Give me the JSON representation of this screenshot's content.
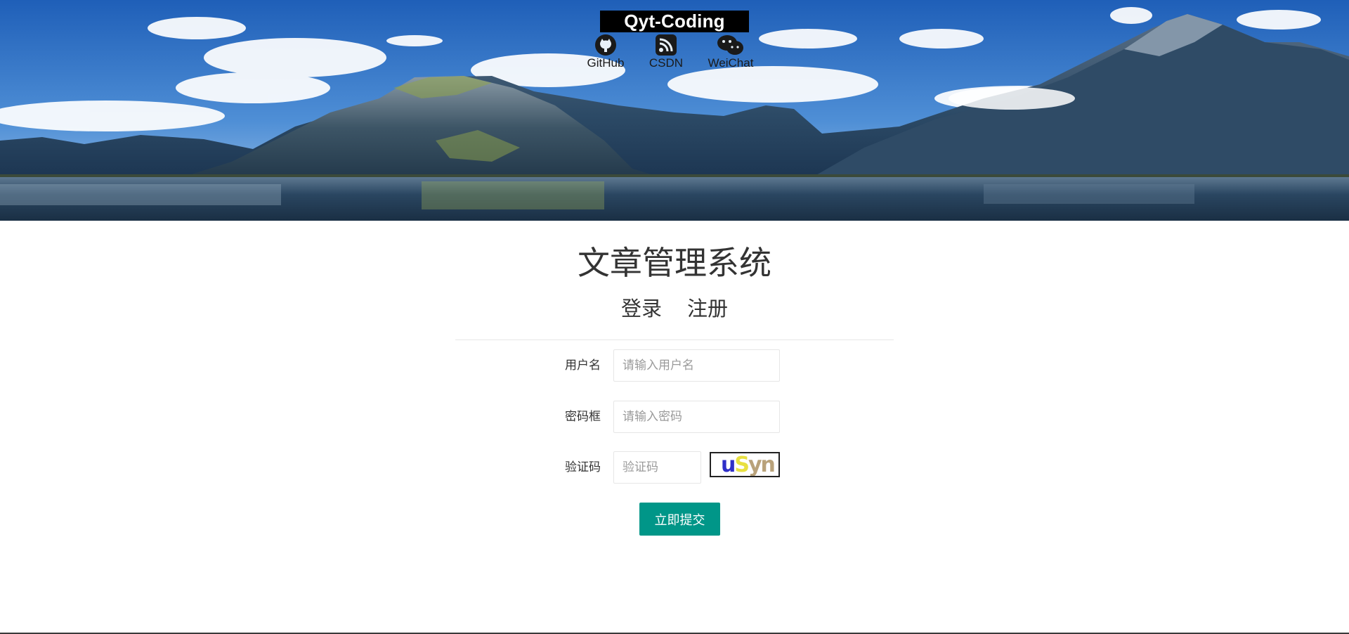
{
  "header": {
    "brand": "Qyt-Coding",
    "links": [
      {
        "label": "GitHub",
        "icon": "github-icon"
      },
      {
        "label": "CSDN",
        "icon": "rss-icon"
      },
      {
        "label": "WeiChat",
        "icon": "wechat-icon"
      }
    ]
  },
  "main": {
    "title": "文章管理系统",
    "tabs": [
      {
        "label": "登录"
      },
      {
        "label": "注册"
      }
    ]
  },
  "form": {
    "username": {
      "label": "用户名",
      "placeholder": "请输入用户名",
      "value": ""
    },
    "password": {
      "label": "密码框",
      "placeholder": "请输入密码",
      "value": ""
    },
    "captcha": {
      "label": "验证码",
      "placeholder": "验证码",
      "value": "",
      "image_text": [
        "u",
        "S",
        "yn"
      ]
    },
    "submit_label": "立即提交"
  },
  "colors": {
    "accent": "#009688",
    "brand_bg": "#000000",
    "brand_fg": "#ffffff",
    "sky": "#2f73c8",
    "lake": "#1f3d5a"
  }
}
